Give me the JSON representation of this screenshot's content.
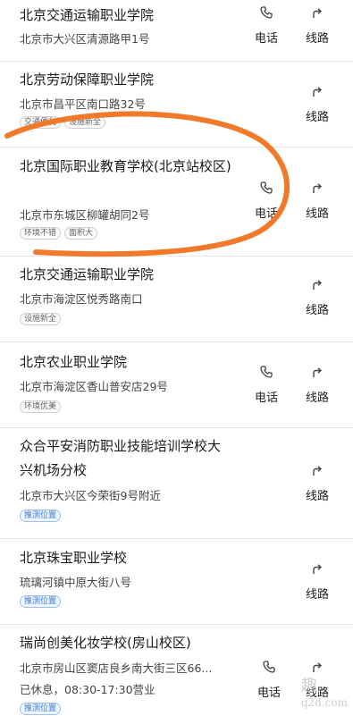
{
  "actions": {
    "phone_label": "电话",
    "route_label": "线路"
  },
  "items": [
    {
      "name": "北京交通运输职业学院",
      "address": "北京市大兴区清源路甲1号",
      "tags": [],
      "hours": ""
    },
    {
      "name": "北京劳动保障职业学院",
      "address": "北京市昌平区南口路32号",
      "tags": [
        "交通便利",
        "设施新全"
      ],
      "hours": ""
    },
    {
      "name": "北京国际职业教育学校(北京站校区)",
      "address": "北京市东城区柳罐胡同2号",
      "tags": [
        "环境不错",
        "面积大"
      ],
      "hours": ""
    },
    {
      "name": "北京交通运输职业学院",
      "address": "北京市海淀区悦秀路南口",
      "tags": [
        "设施新全"
      ],
      "hours": ""
    },
    {
      "name": "北京农业职业学院",
      "address": "北京市海淀区香山普安店29号",
      "tags": [
        "环境优美"
      ],
      "hours": ""
    },
    {
      "name": "众合平安消防职业技能培训学校大兴机场分校",
      "address": "北京市大兴区今荣街9号附近",
      "tags": [
        "推测位置"
      ],
      "hours": ""
    },
    {
      "name": "北京珠宝职业学校",
      "address": "琉璃河镇中原大街八号",
      "tags": [
        "推测位置"
      ],
      "hours": ""
    },
    {
      "name": "瑞尚创美化妆学校(房山校区)",
      "address": "北京市房山区窦店良乡南大街三区66...",
      "tags": [
        "推测位置"
      ],
      "hours": "已休息，08:30-17:30营业"
    }
  ],
  "watermark": {
    "line1": "趣",
    "line2": "q2d.com"
  },
  "colors": {
    "annotation": "#f07a2a",
    "tag_blue": "#3b7bd4"
  }
}
